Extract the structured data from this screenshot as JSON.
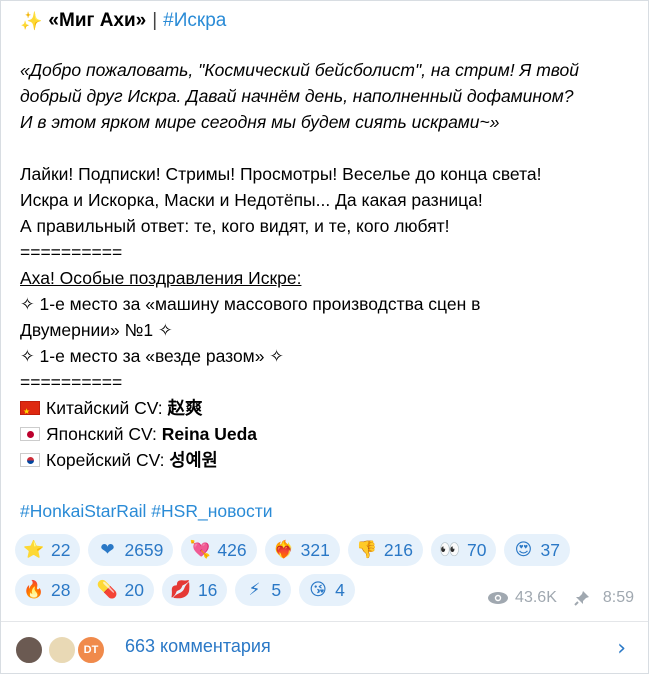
{
  "header": {
    "sparkle_icon": "sparkles",
    "channel": "«Миг Ахи»",
    "separator": "|",
    "tag": "#Искра"
  },
  "intro": [
    "«Добро пожаловать, \"Космический бейсболист\", на стрим! Я твой",
    "добрый друг Искра. Давай начнём день, наполненный дофамином?",
    "И в этом ярком мире сегодня мы будем сиять искрами~»"
  ],
  "body": [
    "Лайки! Подписки! Стримы! Просмотры! Веселье до конца света!",
    "Искра и Искорка, Маски и Недотёпы... Да какая разница!",
    "А правильный ответ: те, кого видят, и те, кого любят!",
    "=========="
  ],
  "congrats_title": "Аха! Особые поздравления Искре:",
  "awards": [
    "✧ 1-е место за «машину массового производства сцен в",
    "Двумернии» №1 ✧",
    "✧ 1-е место за «везде разом» ✧",
    "=========="
  ],
  "cv": [
    {
      "flag": "cn",
      "label": "Китайский CV: ",
      "name": "赵爽"
    },
    {
      "flag": "jp",
      "label": "Японский CV: ",
      "name": "Reina Ueda"
    },
    {
      "flag": "kr",
      "label": "Корейский CV: ",
      "name": "성예원"
    }
  ],
  "hashtags": "#HonkaiStarRail #HSR_новости",
  "reactions_row1": [
    {
      "emoji": "⭐",
      "icon": "star-icon",
      "count": "22"
    },
    {
      "emoji": "❤",
      "icon": "red-heart-icon",
      "count": "2659"
    },
    {
      "emoji": "💘",
      "icon": "heart-arrow-icon",
      "count": "426"
    },
    {
      "emoji": "❤‍🔥",
      "icon": "heart-on-fire-icon",
      "count": "321"
    },
    {
      "emoji": "👎",
      "icon": "thumbs-down-icon",
      "count": "216"
    },
    {
      "emoji": "👀",
      "icon": "eyes-icon",
      "count": "70"
    },
    {
      "emoji": "😍",
      "icon": "heart-eyes-icon",
      "count": "37"
    }
  ],
  "reactions_row2": [
    {
      "emoji": "🔥",
      "icon": "fire-icon",
      "count": "28"
    },
    {
      "emoji": "💊",
      "icon": "pill-icon",
      "count": "20"
    },
    {
      "emoji": "💋",
      "icon": "kiss-mark-icon",
      "count": "16"
    },
    {
      "emoji": "⚡",
      "icon": "lightning-icon",
      "count": "5"
    },
    {
      "emoji": "😘",
      "icon": "kissing-face-icon",
      "count": "4"
    }
  ],
  "meta": {
    "views": "43.6K",
    "time": "8:59"
  },
  "footer": {
    "comments": "663 комментария",
    "avatar3_text": "DT"
  },
  "colors": {
    "link": "#2a8bd6",
    "reaction_bg": "#e6f1fb",
    "meta": "#a0a8b0"
  }
}
